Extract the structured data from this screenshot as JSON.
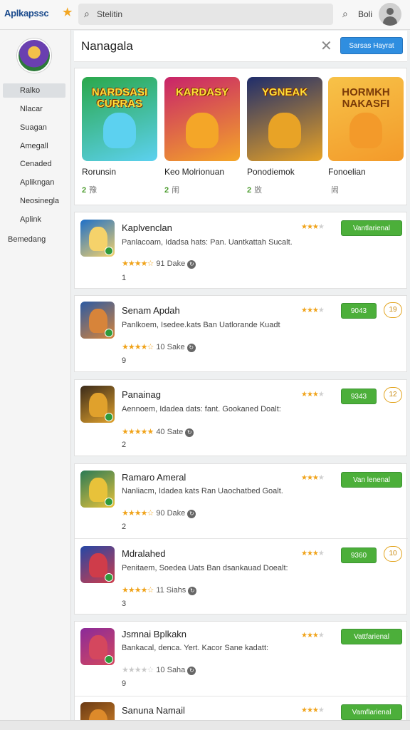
{
  "app": {
    "logo_text": "Aplkapssc"
  },
  "search": {
    "placeholder": "Stelitin"
  },
  "topbar": {
    "bolt_label": "Boli"
  },
  "sidebar": {
    "items": [
      {
        "label": "Ralko",
        "active": true
      },
      {
        "label": "Nlacar"
      },
      {
        "label": "Suagan"
      },
      {
        "label": "Amegall"
      },
      {
        "label": "Cenaded"
      },
      {
        "label": "Aplikngan"
      },
      {
        "label": "Neosinegla"
      },
      {
        "label": "Aplink"
      },
      {
        "label": "Bemedang"
      }
    ]
  },
  "header": {
    "title": "Nanagala",
    "primary_button": "Sarsas Hayrat"
  },
  "featured": [
    {
      "art_title": "NARDSASI CURRAS",
      "name": "Rorunsin",
      "score": "2",
      "meta": "豫",
      "colors": [
        "#2aa84a",
        "#5cd1f0"
      ]
    },
    {
      "art_title": "KARDASY",
      "name": "Keo Molrionuan",
      "score": "2",
      "meta": "闹",
      "colors": [
        "#c8236a",
        "#f4a628"
      ]
    },
    {
      "art_title": "YGNEAK",
      "name": "Ponodiemok",
      "score": "2",
      "meta": "敚",
      "colors": [
        "#1f2d6b",
        "#e8a326"
      ]
    },
    {
      "art_title": "HORMKH NAKASFI",
      "name": "Fonoelian",
      "score": "",
      "meta": "闹",
      "colors": [
        "#f7c248",
        "#f39a2a"
      ]
    }
  ],
  "apps": [
    {
      "name": "Kaplvenclan",
      "desc": "Panlacoam, Idadsa hats: Pan. Uantkattah Sucalt.",
      "rating": "91 Dake",
      "num": "1",
      "action": "Vantlarienal",
      "badge": "",
      "colors": [
        "#1e6fc8",
        "#f5d26a"
      ]
    },
    {
      "name": "Senam Apdah",
      "desc": "Panlkoem, Isedee.kats Ban Uatlorande Kuadt",
      "rating": "10 Sake",
      "num": "9",
      "action": "9043",
      "badge": "19",
      "colors": [
        "#2b5aa3",
        "#d7843a"
      ]
    },
    {
      "name": "Panainag",
      "desc": "Aennoem, Idadea dats: fant. Gookaned Doalt:",
      "rating": "40 Sate",
      "num": "2",
      "action": "9343",
      "badge": "12",
      "colors": [
        "#3a2a1a",
        "#e0a12c"
      ]
    },
    {
      "name": "Ramaro Ameral",
      "desc": "Nanliacm, Idadea kats Ran Uaochatbed Goalt.",
      "rating": "90 Dake",
      "num": "2",
      "action": "Van lenenal",
      "badge": "",
      "colors": [
        "#2a7a55",
        "#e8c23a"
      ]
    },
    {
      "name": "Mdralahed",
      "desc": "Penitaem, Soedea Uats Ban dsankauad Doealt:",
      "rating": "11 Siahs",
      "num": "3",
      "action": "9360",
      "badge": "10",
      "colors": [
        "#2447a6",
        "#cf3c4a"
      ]
    },
    {
      "name": "Jsmnai Bplkakn",
      "desc": "Bankacal, denca. Yert. Kacor Sane kadatt:",
      "rating": "10 Saha",
      "num": "9",
      "action": "Vattfarienal",
      "badge": "",
      "colors": [
        "#8a2a9a",
        "#d4475e"
      ]
    },
    {
      "name": "Sanuna Namail",
      "desc": "",
      "rating": "",
      "num": "",
      "action": "Vamflarienal",
      "badge": "",
      "colors": [
        "#6a3a14",
        "#dd8a2a"
      ]
    }
  ]
}
